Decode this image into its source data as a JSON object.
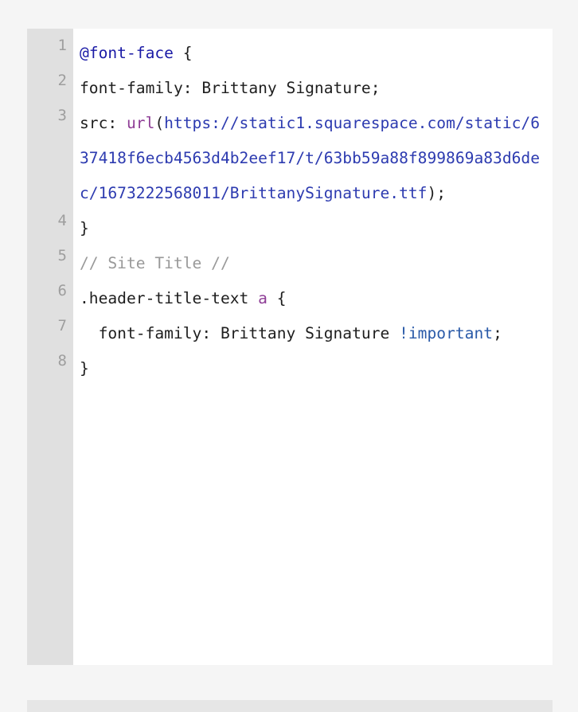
{
  "editor": {
    "lines": [
      {
        "number": "1",
        "tokens": [
          {
            "t": "@font-face",
            "k": "atrule"
          },
          {
            "t": " {",
            "k": "plain"
          }
        ]
      },
      {
        "number": "2",
        "tokens": [
          {
            "t": "font-family: Brittany Signature;",
            "k": "plain"
          }
        ]
      },
      {
        "number": "3",
        "tokens": [
          {
            "t": "src: ",
            "k": "plain"
          },
          {
            "t": "url",
            "k": "func"
          },
          {
            "t": "(",
            "k": "plain"
          },
          {
            "t": "https://static1.squarespace.com/static/637418f6ecb4563d4b2eef17/t/63bb59a88f899869a83d6dec/1673222568011/BrittanySignature.ttf",
            "k": "url"
          },
          {
            "t": ");",
            "k": "plain"
          }
        ]
      },
      {
        "number": "4",
        "tokens": [
          {
            "t": "}",
            "k": "plain"
          }
        ]
      },
      {
        "number": "5",
        "tokens": [
          {
            "t": "// Site Title //",
            "k": "comment"
          }
        ]
      },
      {
        "number": "6",
        "tokens": [
          {
            "t": ".header-title-text ",
            "k": "plain"
          },
          {
            "t": "a",
            "k": "tag"
          },
          {
            "t": " {",
            "k": "plain"
          }
        ]
      },
      {
        "number": "7",
        "tokens": [
          {
            "t": "  font-family: Brittany Signature ",
            "k": "plain"
          },
          {
            "t": "!important",
            "k": "important"
          },
          {
            "t": ";",
            "k": "plain"
          }
        ]
      },
      {
        "number": "8",
        "tokens": [
          {
            "t": "}",
            "k": "plain"
          }
        ]
      }
    ]
  }
}
